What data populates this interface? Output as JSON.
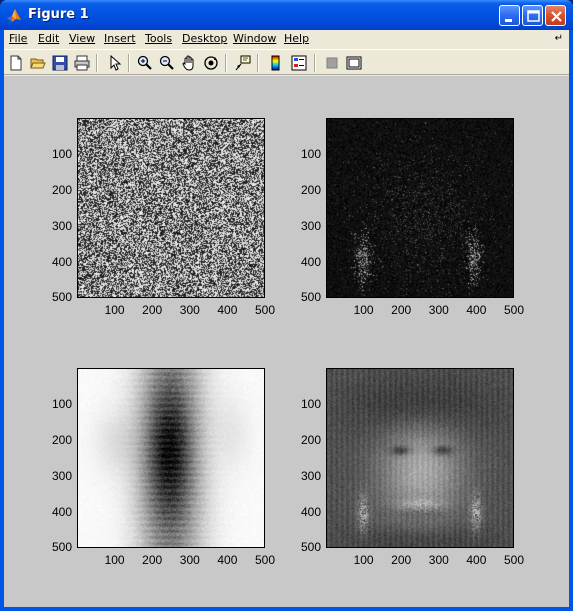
{
  "window": {
    "title": "Figure 1"
  },
  "menu": [
    "File",
    "Edit",
    "View",
    "Insert",
    "Tools",
    "Desktop",
    "Window",
    "Help"
  ],
  "menu_underline_index": [
    0,
    0,
    0,
    0,
    0,
    0,
    0,
    0
  ],
  "toolbar": {
    "icons": [
      "new-figure-icon",
      "open-file-icon",
      "save-icon",
      "print-icon",
      "edit-plot-arrow-icon",
      "zoom-in-icon",
      "zoom-out-icon",
      "pan-hand-icon",
      "rotate-3d-icon",
      "data-cursor-icon",
      "insert-colorbar-icon",
      "insert-legend-icon",
      "hide-plot-tools-icon",
      "show-plot-tools-icon"
    ]
  },
  "subplots": [
    {
      "name": "random-noise",
      "yticks": [
        "100",
        "200",
        "300",
        "400",
        "500"
      ],
      "xticks": [
        "100",
        "200",
        "300",
        "400",
        "500"
      ]
    },
    {
      "name": "dark-faint-face",
      "yticks": [
        "100",
        "200",
        "300",
        "400",
        "500"
      ],
      "xticks": [
        "100",
        "200",
        "300",
        "400",
        "500"
      ]
    },
    {
      "name": "blurred-blob",
      "yticks": [
        "100",
        "200",
        "300",
        "400",
        "500"
      ],
      "xticks": [
        "100",
        "200",
        "300",
        "400",
        "500"
      ]
    },
    {
      "name": "reconstructed-face",
      "yticks": [
        "100",
        "200",
        "300",
        "400",
        "500"
      ],
      "xticks": [
        "100",
        "200",
        "300",
        "400",
        "500"
      ]
    }
  ],
  "colors": {
    "figure_bg": "#c8c8c8",
    "titlebar": "#0054e3",
    "chrome": "#ece9d8"
  }
}
